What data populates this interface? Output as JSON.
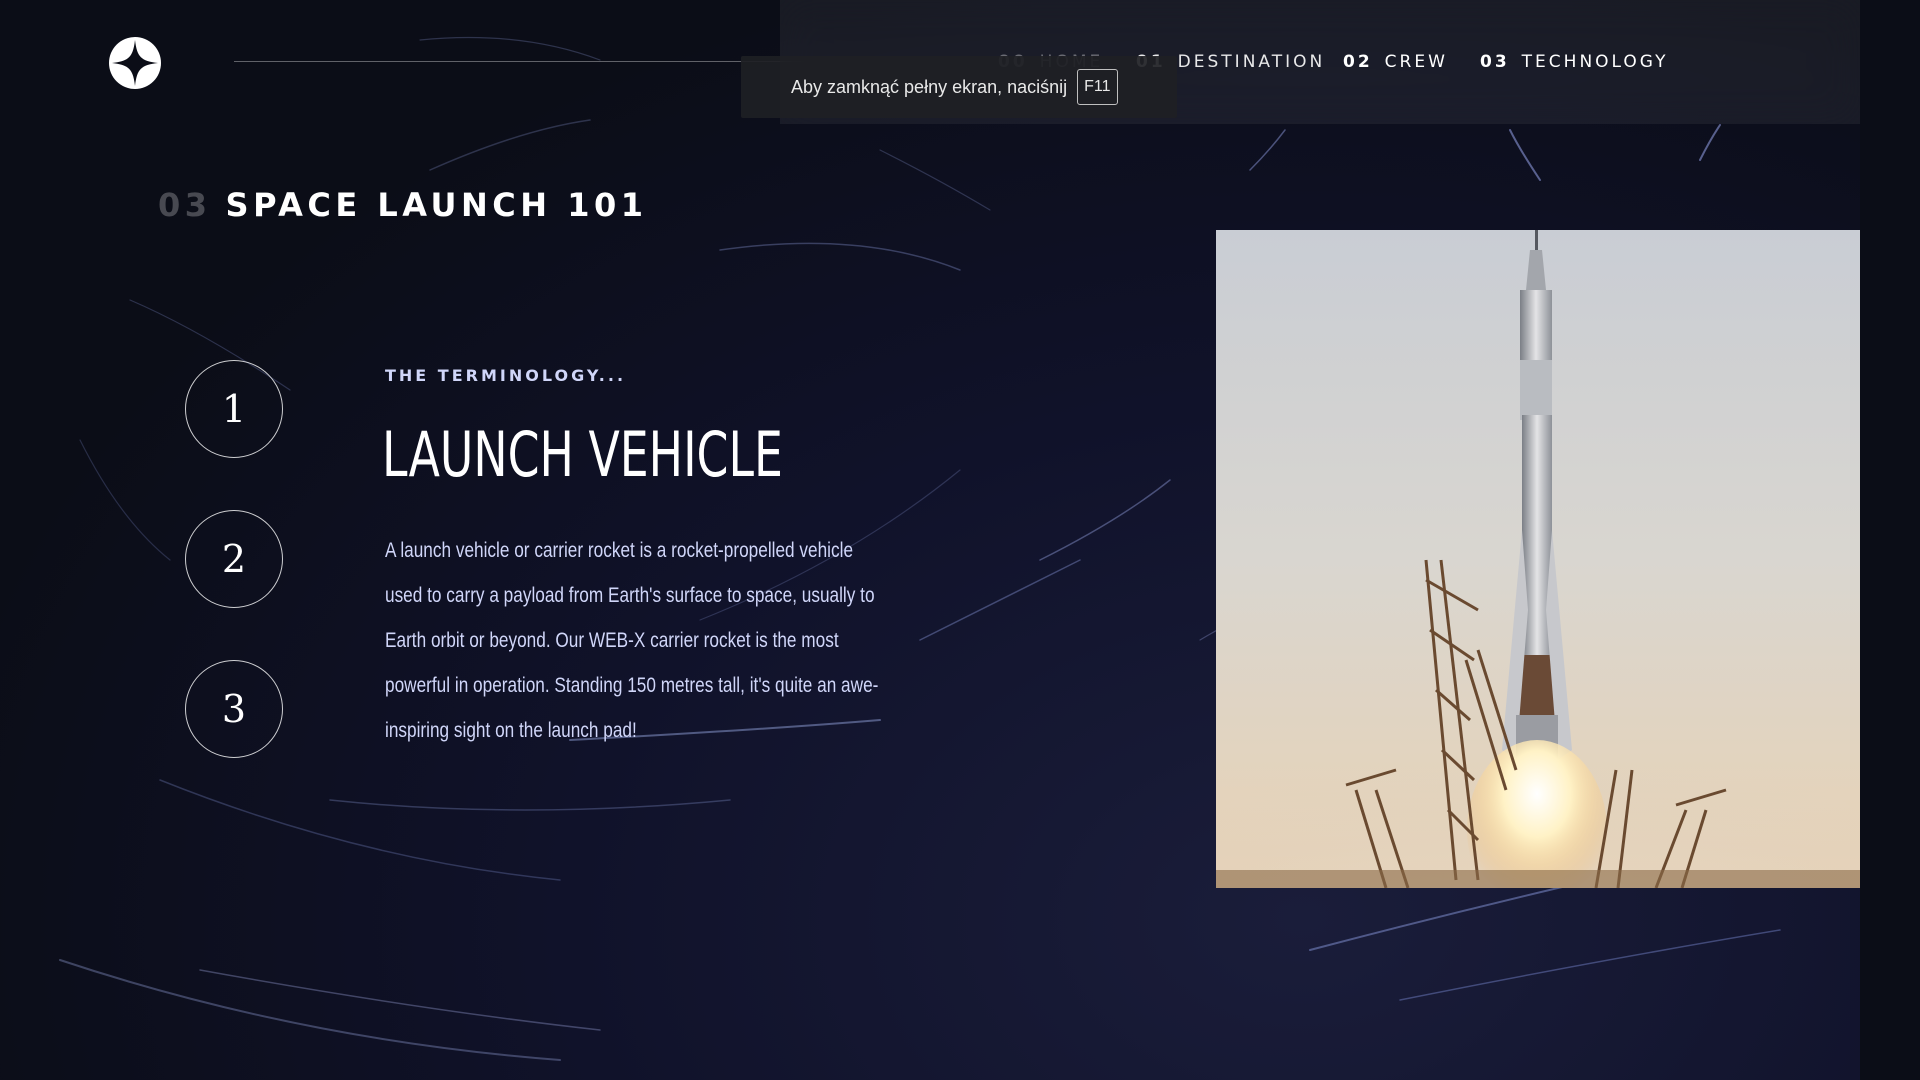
{
  "nav": {
    "items": [
      {
        "num": "00",
        "label": "HOME"
      },
      {
        "num": "01",
        "label": "DESTINATION"
      },
      {
        "num": "02",
        "label": "CREW"
      },
      {
        "num": "03",
        "label": "TECHNOLOGY"
      }
    ]
  },
  "toast": {
    "text": "Aby zamknąć pełny ekran, naciśnij",
    "key": "F11"
  },
  "page": {
    "number": "03",
    "heading": "SPACE LAUNCH 101"
  },
  "steps": [
    "1",
    "2",
    "3"
  ],
  "content": {
    "eyebrow": "THE TERMINOLOGY...",
    "title": "LAUNCH VEHICLE",
    "body": "A launch vehicle or carrier rocket is a rocket-propelled vehicle used to carry a payload from Earth's surface to space, usually to Earth orbit or beyond. Our WEB-X carrier rocket is the most powerful in operation. Standing 150 metres tall, it's quite an awe-inspiring sight on the launch pad!"
  },
  "colors": {
    "background": "#0b0d17",
    "text_light": "#d0d6f9",
    "white": "#ffffff"
  },
  "icons": {
    "logo": "four-point-star-logo"
  }
}
